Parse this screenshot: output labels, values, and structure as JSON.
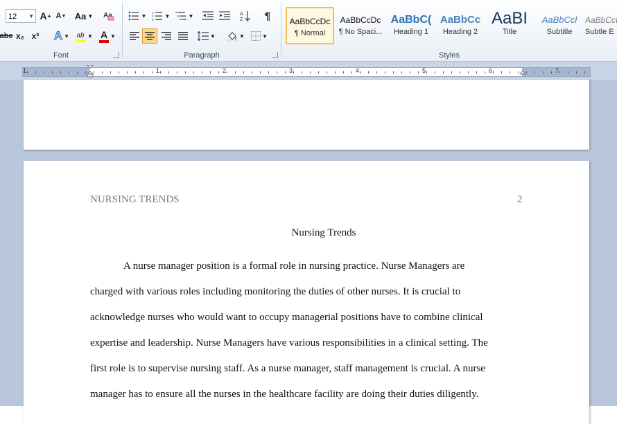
{
  "ribbon": {
    "font_group": {
      "label": "Font",
      "size_value": "12",
      "grow_font": "A",
      "shrink_font": "A",
      "change_case": "Aa",
      "strike": "abe",
      "subscript": "x₂",
      "superscript": "x²",
      "text_effects": "A",
      "highlight": "ab",
      "font_color": "A"
    },
    "paragraph_group": {
      "label": "Paragraph",
      "pilcrow": "¶"
    },
    "styles_group": {
      "label": "Styles",
      "tiles": [
        {
          "sample": "AaBbCcDc",
          "name": "¶ Normal"
        },
        {
          "sample": "AaBbCcDc",
          "name": "¶ No Spaci..."
        },
        {
          "sample": "AaBbC(",
          "name": "Heading 1"
        },
        {
          "sample": "AaBbCc",
          "name": "Heading 2"
        },
        {
          "sample": "AaBI",
          "name": "Title"
        },
        {
          "sample": "AaBbCcl",
          "name": "Subtitle"
        },
        {
          "sample": "AaBbCcD",
          "name": "Subtle E"
        }
      ]
    }
  },
  "ruler": {
    "numbers": [
      "1",
      "1",
      "2",
      "3",
      "4",
      "5",
      "6",
      "7"
    ]
  },
  "document": {
    "header_left": "NURSING TRENDS",
    "header_right": "2",
    "title": "Nursing Trends",
    "lines": [
      "A nurse manager position is a formal role in nursing practice. Nurse Managers are",
      "charged with various roles including monitoring the duties of other nurses. It is crucial to",
      "acknowledge nurses who would want to occupy managerial positions have to combine clinical",
      "expertise and leadership. Nurse Managers have various responsibilities in a clinical setting. The",
      "first role is to supervise nursing staff. As a nurse manager, staff management is crucial. A nurse",
      "manager has to ensure all the nurses in the healthcare facility are doing their duties diligently."
    ]
  },
  "colors": {
    "highlight": "#ffff00",
    "font_color": "#e00000",
    "heading_blue": "#2e74b5",
    "selected_style_border": "#f1c14f"
  }
}
